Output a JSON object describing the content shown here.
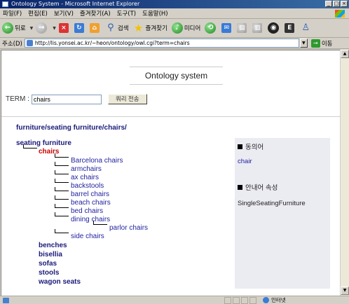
{
  "window": {
    "title": "Ontology System - Microsoft Internet Explorer",
    "controls": [
      "_",
      "□",
      "×"
    ]
  },
  "menubar": {
    "items": [
      "파일(F)",
      "편집(E)",
      "보기(V)",
      "즐겨찾기(A)",
      "도구(T)",
      "도움말(H)"
    ]
  },
  "toolbar": {
    "back_label": "뒤로",
    "search_label": "검색",
    "favorites_label": "즐겨찾기",
    "media_label": "미디어"
  },
  "address": {
    "label": "주소(D)",
    "url": "http://lis.yonsei.ac.kr/~heon/ontology/owl.cgi?term=chairs",
    "go_label": "이동"
  },
  "page": {
    "header": "Ontology system",
    "term_label": "TERM :",
    "term_value": "chairs",
    "submit_label": "쿼리 전송",
    "path": "furniture/seating furniture/chairs/",
    "tree": {
      "root": "seating furniture",
      "current": "chairs",
      "subclasses": [
        "Barcelona chairs",
        "armchairs",
        "ax chairs",
        "backstools",
        "barrel chairs",
        "beach chairs",
        "bed chairs",
        "dining chairs"
      ],
      "grandchild": "parlor chairs",
      "last_subclass": "side chairs",
      "siblings": [
        "benches",
        "bisellia",
        "sofas",
        "stools",
        "wagon seats"
      ]
    },
    "side": {
      "synonym_heading": "동의어",
      "synonym_value": "chair",
      "guide_heading": "안내어 속성",
      "guide_value": "SingleSeatingFurniture"
    }
  },
  "status": {
    "zone": "인터넷"
  },
  "colors": {
    "current_node": "#cc0000",
    "link": "#1f1f9f",
    "bold_node": "#1a1a7a",
    "side_panel_bg": "#ebebf2"
  }
}
